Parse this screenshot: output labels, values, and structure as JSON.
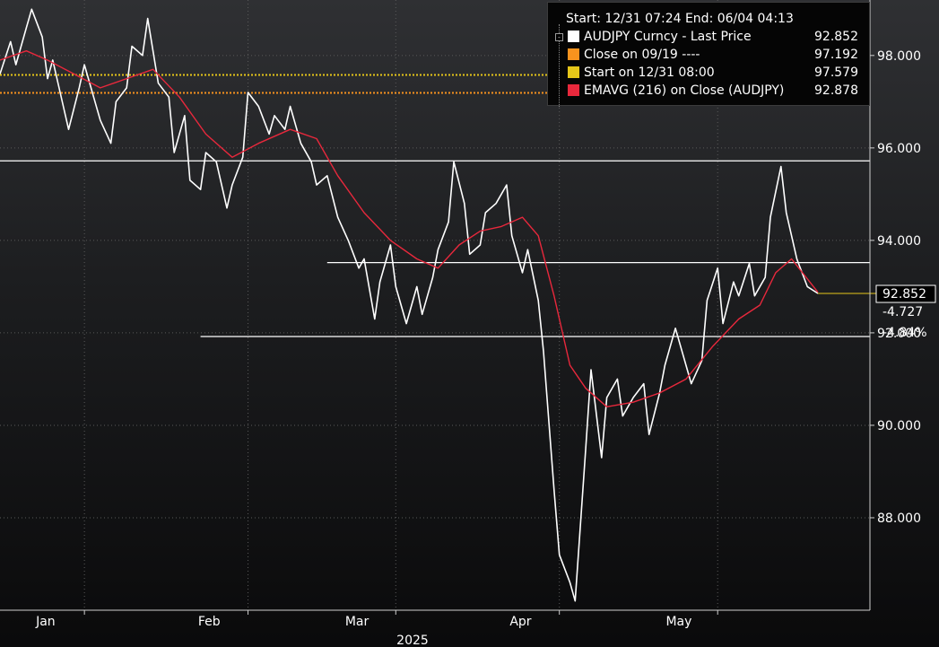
{
  "chart_data": {
    "type": "line",
    "x_range": [
      "2024-12-31",
      "2025-06-04"
    ],
    "ylim": [
      86.0,
      99.2
    ],
    "y_ticks": [
      "98.000",
      "96.000",
      "94.000",
      "92.000",
      "90.000",
      "88.000"
    ],
    "y_tick_values": [
      98,
      96,
      94,
      92,
      90,
      88
    ],
    "x_ticks": [
      {
        "label": "Jan",
        "date": "2025-01-01"
      },
      {
        "label": "Feb",
        "date": "2025-02-01"
      },
      {
        "label": "Mar",
        "date": "2025-03-01"
      },
      {
        "label": "Apr",
        "date": "2025-04-01"
      },
      {
        "label": "May",
        "date": "2025-05-01"
      }
    ],
    "x_year_label": "2025",
    "legend_header": "Start: 12/31 07:24 End: 06/04 04:13",
    "legend": [
      {
        "label": "AUDJPY Curncy - Last Price",
        "value": "92.852",
        "color": "#ffffff"
      },
      {
        "label": "Close on 09/19 ----",
        "value": "97.192",
        "color": "#f7931e"
      },
      {
        "label": "Start on 12/31 08:00",
        "value": "97.579",
        "color": "#e6c619"
      },
      {
        "label": "EMAVG (216)  on Close (AUDJPY)",
        "value": "92.878",
        "color": "#e8283c"
      }
    ],
    "hlines": [
      {
        "value": 97.192,
        "color": "#f7931e",
        "style": "dotted"
      },
      {
        "value": 97.579,
        "color": "#e6c619",
        "style": "dotted"
      },
      {
        "value": 95.72,
        "color": "#ffffff",
        "style": "solid"
      },
      {
        "value": 93.52,
        "color": "#ffffff",
        "style": "solid",
        "start": "2025-03-03"
      },
      {
        "value": 91.92,
        "color": "#ffffff",
        "style": "solid",
        "start": "2025-02-07"
      }
    ],
    "last_price_tag": "92.852",
    "change_tag": "-4.727",
    "change_pct_tag": "-4.84%",
    "price_series": {
      "name": "AUDJPY Curncy - Last Price",
      "color": "#ffffff",
      "points": [
        [
          "2024-12-31",
          97.6
        ],
        [
          "2025-01-02",
          98.3
        ],
        [
          "2025-01-03",
          97.8
        ],
        [
          "2025-01-05",
          98.6
        ],
        [
          "2025-01-06",
          99.0
        ],
        [
          "2025-01-08",
          98.4
        ],
        [
          "2025-01-09",
          97.5
        ],
        [
          "2025-01-10",
          97.9
        ],
        [
          "2025-01-12",
          96.9
        ],
        [
          "2025-01-13",
          96.4
        ],
        [
          "2025-01-15",
          97.3
        ],
        [
          "2025-01-16",
          97.8
        ],
        [
          "2025-01-18",
          97.0
        ],
        [
          "2025-01-19",
          96.6
        ],
        [
          "2025-01-21",
          96.1
        ],
        [
          "2025-01-22",
          97.0
        ],
        [
          "2025-01-24",
          97.3
        ],
        [
          "2025-01-25",
          98.2
        ],
        [
          "2025-01-27",
          98.0
        ],
        [
          "2025-01-28",
          98.8
        ],
        [
          "2025-01-30",
          97.4
        ],
        [
          "2025-02-01",
          97.1
        ],
        [
          "2025-02-02",
          95.9
        ],
        [
          "2025-02-04",
          96.7
        ],
        [
          "2025-02-05",
          95.3
        ],
        [
          "2025-02-07",
          95.1
        ],
        [
          "2025-02-08",
          95.9
        ],
        [
          "2025-02-10",
          95.7
        ],
        [
          "2025-02-12",
          94.7
        ],
        [
          "2025-02-13",
          95.2
        ],
        [
          "2025-02-15",
          95.8
        ],
        [
          "2025-02-16",
          97.2
        ],
        [
          "2025-02-18",
          96.9
        ],
        [
          "2025-02-20",
          96.3
        ],
        [
          "2025-02-21",
          96.7
        ],
        [
          "2025-02-23",
          96.4
        ],
        [
          "2025-02-24",
          96.9
        ],
        [
          "2025-02-26",
          96.1
        ],
        [
          "2025-02-28",
          95.7
        ],
        [
          "2025-03-01",
          95.2
        ],
        [
          "2025-03-03",
          95.4
        ],
        [
          "2025-03-05",
          94.5
        ],
        [
          "2025-03-07",
          94.0
        ],
        [
          "2025-03-09",
          93.4
        ],
        [
          "2025-03-10",
          93.6
        ],
        [
          "2025-03-12",
          92.3
        ],
        [
          "2025-03-13",
          93.1
        ],
        [
          "2025-03-15",
          93.9
        ],
        [
          "2025-03-16",
          93.0
        ],
        [
          "2025-03-18",
          92.2
        ],
        [
          "2025-03-20",
          93.0
        ],
        [
          "2025-03-21",
          92.4
        ],
        [
          "2025-03-23",
          93.2
        ],
        [
          "2025-03-24",
          93.8
        ],
        [
          "2025-03-26",
          94.4
        ],
        [
          "2025-03-27",
          95.7
        ],
        [
          "2025-03-29",
          94.8
        ],
        [
          "2025-03-30",
          93.7
        ],
        [
          "2025-04-01",
          93.9
        ],
        [
          "2025-04-02",
          94.6
        ],
        [
          "2025-04-04",
          94.8
        ],
        [
          "2025-04-06",
          95.2
        ],
        [
          "2025-04-07",
          94.1
        ],
        [
          "2025-04-09",
          93.3
        ],
        [
          "2025-04-10",
          93.8
        ],
        [
          "2025-04-12",
          92.7
        ],
        [
          "2025-04-13",
          91.6
        ],
        [
          "2025-04-15",
          88.6
        ],
        [
          "2025-04-16",
          87.2
        ],
        [
          "2025-04-18",
          86.6
        ],
        [
          "2025-04-19",
          86.2
        ],
        [
          "2025-04-21",
          89.5
        ],
        [
          "2025-04-22",
          91.2
        ],
        [
          "2025-04-24",
          89.3
        ],
        [
          "2025-04-25",
          90.6
        ],
        [
          "2025-04-27",
          91.0
        ],
        [
          "2025-04-28",
          90.2
        ],
        [
          "2025-04-30",
          90.6
        ],
        [
          "2025-05-02",
          90.9
        ],
        [
          "2025-05-03",
          89.8
        ],
        [
          "2025-05-05",
          90.7
        ],
        [
          "2025-05-06",
          91.3
        ],
        [
          "2025-05-08",
          92.1
        ],
        [
          "2025-05-10",
          91.3
        ],
        [
          "2025-05-11",
          90.9
        ],
        [
          "2025-05-13",
          91.4
        ],
        [
          "2025-05-14",
          92.7
        ],
        [
          "2025-05-16",
          93.4
        ],
        [
          "2025-05-17",
          92.2
        ],
        [
          "2025-05-19",
          93.1
        ],
        [
          "2025-05-20",
          92.8
        ],
        [
          "2025-05-22",
          93.5
        ],
        [
          "2025-05-23",
          92.8
        ],
        [
          "2025-05-25",
          93.2
        ],
        [
          "2025-05-26",
          94.5
        ],
        [
          "2025-05-28",
          95.6
        ],
        [
          "2025-05-29",
          94.6
        ],
        [
          "2025-05-31",
          93.6
        ],
        [
          "2025-06-02",
          93.0
        ],
        [
          "2025-06-04",
          92.852
        ]
      ]
    },
    "ema_series": {
      "name": "EMAVG (216)  on Close (AUDJPY)",
      "color": "#e8283c",
      "points": [
        [
          "2024-12-31",
          97.9
        ],
        [
          "2025-01-05",
          98.1
        ],
        [
          "2025-01-09",
          97.9
        ],
        [
          "2025-01-14",
          97.6
        ],
        [
          "2025-01-19",
          97.3
        ],
        [
          "2025-01-24",
          97.5
        ],
        [
          "2025-01-29",
          97.7
        ],
        [
          "2025-02-03",
          97.1
        ],
        [
          "2025-02-08",
          96.3
        ],
        [
          "2025-02-13",
          95.8
        ],
        [
          "2025-02-18",
          96.1
        ],
        [
          "2025-02-24",
          96.4
        ],
        [
          "2025-03-01",
          96.2
        ],
        [
          "2025-03-05",
          95.4
        ],
        [
          "2025-03-10",
          94.6
        ],
        [
          "2025-03-15",
          94.0
        ],
        [
          "2025-03-20",
          93.6
        ],
        [
          "2025-03-24",
          93.4
        ],
        [
          "2025-03-28",
          93.9
        ],
        [
          "2025-04-01",
          94.2
        ],
        [
          "2025-04-05",
          94.3
        ],
        [
          "2025-04-09",
          94.5
        ],
        [
          "2025-04-12",
          94.1
        ],
        [
          "2025-04-15",
          92.8
        ],
        [
          "2025-04-18",
          91.3
        ],
        [
          "2025-04-21",
          90.8
        ],
        [
          "2025-04-25",
          90.4
        ],
        [
          "2025-04-30",
          90.5
        ],
        [
          "2025-05-05",
          90.7
        ],
        [
          "2025-05-10",
          91.0
        ],
        [
          "2025-05-15",
          91.7
        ],
        [
          "2025-05-20",
          92.3
        ],
        [
          "2025-05-24",
          92.6
        ],
        [
          "2025-05-27",
          93.3
        ],
        [
          "2025-05-30",
          93.6
        ],
        [
          "2025-06-04",
          92.878
        ]
      ]
    }
  }
}
